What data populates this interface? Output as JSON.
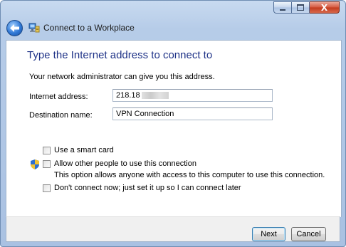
{
  "window": {
    "title": "Connect to a Workplace",
    "caption_buttons": [
      "minimize-icon",
      "maximize-icon",
      "close-icon"
    ],
    "close_glyph": "X"
  },
  "page": {
    "main_instruction": "Type the Internet address to connect to",
    "subtext": "Your network administrator can give you this address."
  },
  "fields": {
    "internet_address": {
      "label": "Internet address:",
      "value": "218.18"
    },
    "destination_name": {
      "label": "Destination name:",
      "value": "VPN Connection"
    }
  },
  "options": {
    "smart_card": {
      "label": "Use a smart card",
      "checked": false
    },
    "allow_others": {
      "label": "Allow other people to use this connection",
      "note": "This option allows anyone with access to this computer to use this connection.",
      "checked": false,
      "icon": "uac-shield-icon"
    },
    "dont_connect": {
      "label": "Don't connect now; just set it up so I can connect later",
      "checked": false
    }
  },
  "buttons": {
    "next": "Next",
    "cancel": "Cancel"
  },
  "colors": {
    "instruction": "#1e3287",
    "frame": "#b6cce8",
    "close": "#c23a1d"
  }
}
